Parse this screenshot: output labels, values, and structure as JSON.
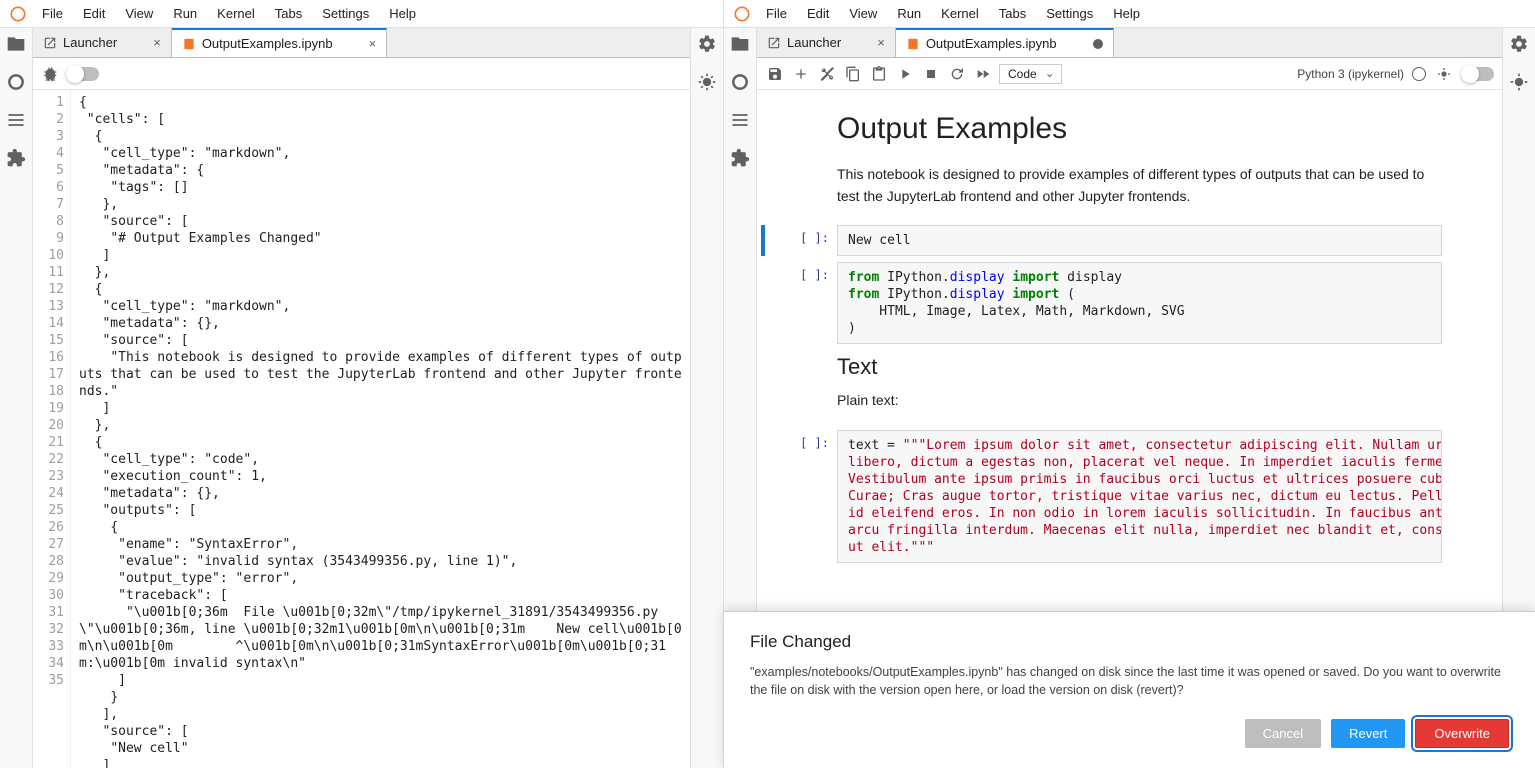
{
  "menu": [
    "File",
    "Edit",
    "View",
    "Run",
    "Kernel",
    "Tabs",
    "Settings",
    "Help"
  ],
  "tabs": {
    "launcher": "Launcher",
    "notebook": "OutputExamples.ipynb"
  },
  "left_editor": {
    "lines": [
      "{",
      " \"cells\": [",
      "  {",
      "   \"cell_type\": \"markdown\",",
      "   \"metadata\": {",
      "    \"tags\": []",
      "   },",
      "   \"source\": [",
      "    \"# Output Examples Changed\"",
      "   ]",
      "  },",
      "  {",
      "   \"cell_type\": \"markdown\",",
      "   \"metadata\": {},",
      "   \"source\": [",
      "    \"This notebook is designed to provide examples of different types of outputs that can be used to test the JupyterLab frontend and other Jupyter frontends.\"",
      "   ]",
      "  },",
      "  {",
      "   \"cell_type\": \"code\",",
      "   \"execution_count\": 1,",
      "   \"metadata\": {},",
      "   \"outputs\": [",
      "    {",
      "     \"ename\": \"SyntaxError\",",
      "     \"evalue\": \"invalid syntax (3543499356.py, line 1)\",",
      "     \"output_type\": \"error\",",
      "     \"traceback\": [",
      "      \"\\u001b[0;36m  File \\u001b[0;32m\\\"/tmp/ipykernel_31891/3543499356.py\\\"\\u001b[0;36m, line \\u001b[0;32m1\\u001b[0m\\n\\u001b[0;31m    New cell\\u001b[0m\\n\\u001b[0m        ^\\u001b[0m\\n\\u001b[0;31mSyntaxError\\u001b[0m\\u001b[0;31m:\\u001b[0m invalid syntax\\n\"",
      "     ]",
      "    }",
      "   ],",
      "   \"source\": [",
      "    \"New cell\"",
      "   ]"
    ]
  },
  "notebook": {
    "title_h1": "Output Examples",
    "intro": "This notebook is designed to provide examples of different types of outputs that can be used to test the JupyterLab frontend and other Jupyter frontends.",
    "cell1_prompt": "[ ]:",
    "cell1_code": "New cell",
    "cell2_prompt": "[ ]:",
    "cell2_line1_kw1": "from",
    "cell2_line1_mod1": " IPython.",
    "cell2_line1_mod2": "display ",
    "cell2_line1_kw2": "import",
    "cell2_line1_rest": " display",
    "cell2_line2_kw1": "from",
    "cell2_line2_mod1": " IPython.",
    "cell2_line2_mod2": "display ",
    "cell2_line2_kw2": "import",
    "cell2_line2_rest": " (",
    "cell2_line3": "    HTML, Image, Latex, Math, Markdown, SVG",
    "cell2_line4": ")",
    "h2_text": "Text",
    "plain_label": "Plain text:",
    "cell3_prompt": "[ ]:",
    "cell3_var": "text ",
    "cell3_eq": "= ",
    "cell3_str": "\"\"\"Lorem ipsum dolor sit amet, consectetur adipiscing elit. Nullam urna\nlibero, dictum a egestas non, placerat vel neque. In imperdiet iaculis fermentu\nVestibulum ante ipsum primis in faucibus orci luctus et ultrices posuere cubili\nCurae; Cras augue tortor, tristique vitae varius nec, dictum eu lectus. Pellent\nid eleifend eros. In non odio in lorem iaculis sollicitudin. In faucibus ante u\narcu fringilla interdum. Maecenas elit nulla, imperdiet nec blandit et, consequ\nut elit.\"\"\"",
    "tail_line": "id eleifend eros. In non odio in lorem iaculis sollicitudin. In faucibus ante"
  },
  "toolbar_right": {
    "cell_type": "Code",
    "kernel": "Python 3 (ipykernel)"
  },
  "dialog": {
    "title": "File Changed",
    "body": "\"examples/notebooks/OutputExamples.ipynb\" has changed on disk since the last time it was opened or saved. Do you want to overwrite the file on disk with the version open here, or load the version on disk (revert)?",
    "cancel": "Cancel",
    "revert": "Revert",
    "overwrite": "Overwrite"
  }
}
